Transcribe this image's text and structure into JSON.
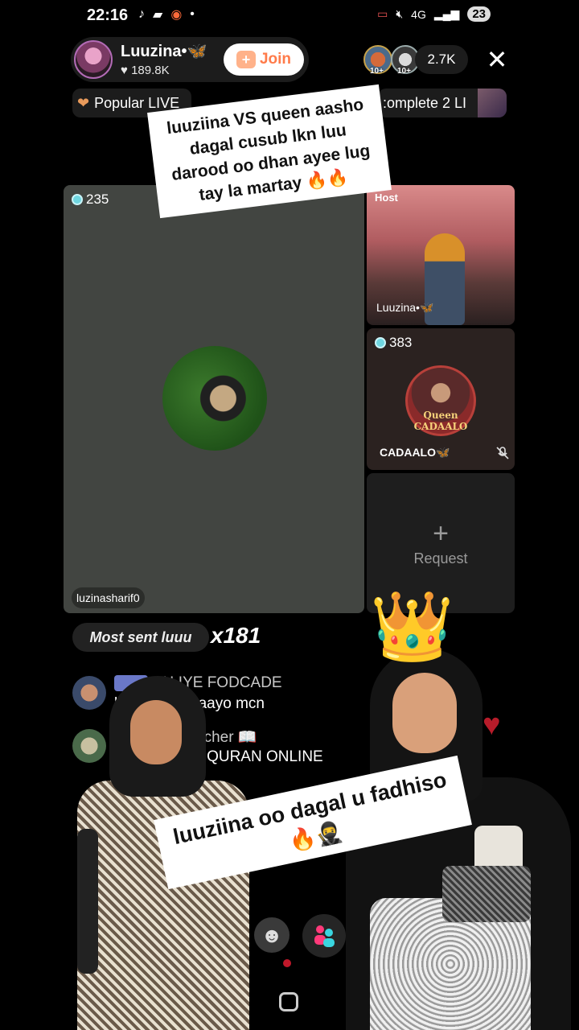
{
  "status": {
    "time": "22:16",
    "network": "4G",
    "battery": "23"
  },
  "host": {
    "name": "Luuzina•🦋",
    "likes": "189.8K",
    "join_label": "Join"
  },
  "viewers": {
    "badge1": "10+",
    "badge2": "10+",
    "count": "2.7K"
  },
  "tags": {
    "popular": "Popular LIVE",
    "complete": ":omplete 2 LI"
  },
  "caption_top": "luuziina  VS queen aasho dagal cusub lkn luu darood oo dhan ayee lug tay la martay 🔥🔥",
  "grid": {
    "main": {
      "gems": "235",
      "user": "luzinasharif0"
    },
    "host_tile": {
      "label": "Host",
      "name": "Luuzina•🦋"
    },
    "guest_tile": {
      "gems": "383",
      "name": "CADAALO🦋",
      "avatar_text": "Queen CADAALO"
    },
    "request_label": "Request"
  },
  "gift": {
    "label": "Most sent luuu",
    "multiplier": "x181"
  },
  "chat": [
    {
      "user": "FALIYE FODCADE",
      "message": "l... pqabo abaayo mcn"
    },
    {
      "user": "Q... nline Teacher 📖",
      "message": "QC...BAHAN QURAN ONLINE"
    }
  ],
  "caption_bottom": "luuziina oo dagal u fadhiso 🔥🥷",
  "crown": "👑",
  "emoji_icon": "☻"
}
